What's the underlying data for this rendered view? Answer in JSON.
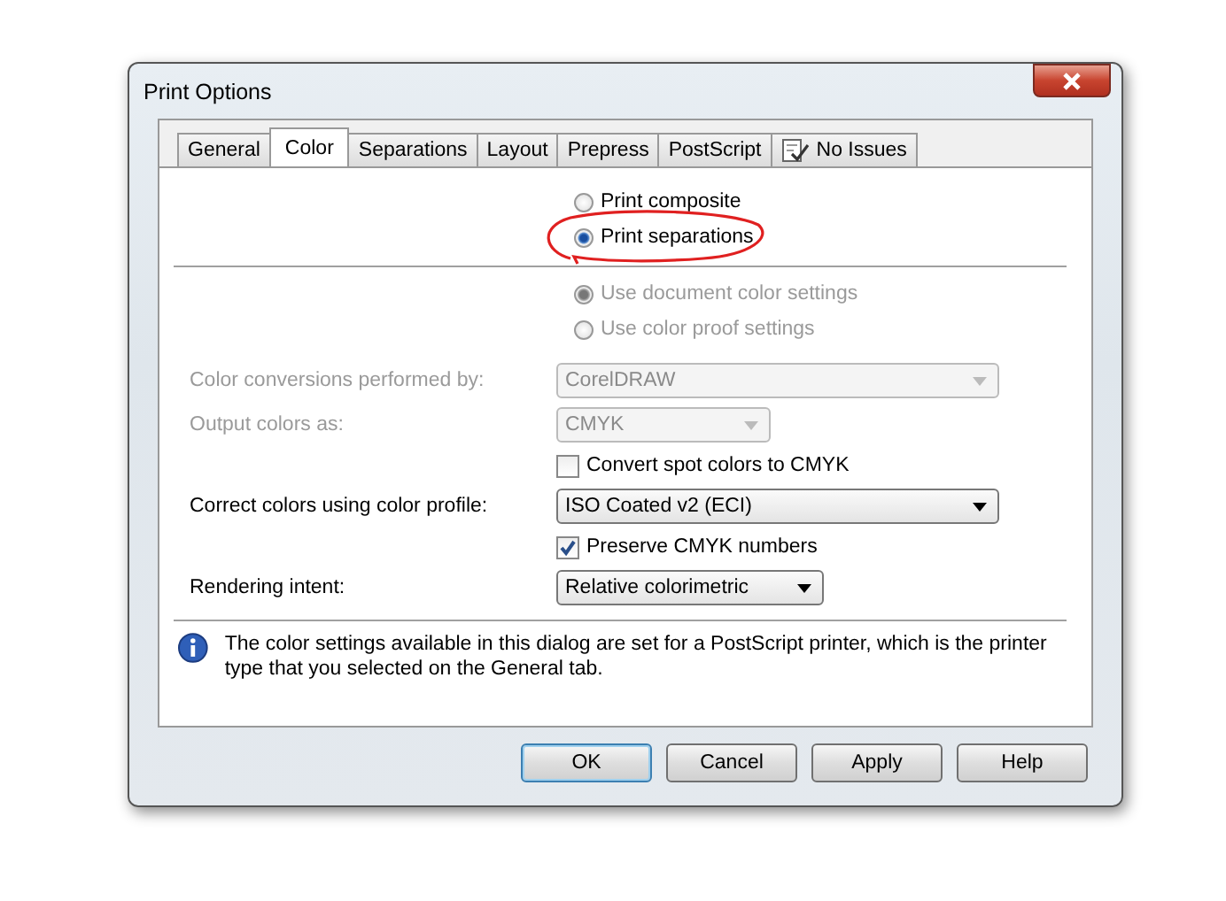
{
  "window": {
    "title": "Print Options"
  },
  "tabs": [
    {
      "label": "General",
      "selected": false,
      "kind": "text"
    },
    {
      "label": "Color",
      "selected": true,
      "kind": "text"
    },
    {
      "label": "Separations",
      "selected": false,
      "kind": "text"
    },
    {
      "label": "Layout",
      "selected": false,
      "kind": "text"
    },
    {
      "label": "Prepress",
      "selected": false,
      "kind": "text"
    },
    {
      "label": "PostScript",
      "selected": false,
      "kind": "text"
    },
    {
      "label": "No Issues",
      "selected": false,
      "kind": "check"
    }
  ],
  "output_mode": [
    {
      "label": "Print composite",
      "selected": false,
      "circled": false
    },
    {
      "label": "Print separations",
      "selected": true,
      "circled": true
    }
  ],
  "color_source": [
    {
      "label": "Use document color settings",
      "selected": true,
      "disabled": true
    },
    {
      "label": "Use color proof settings",
      "selected": false,
      "disabled": true
    }
  ],
  "settings": [
    {
      "kind": "dropdown",
      "label": "Color conversions performed by:",
      "value": "CorelDRAW",
      "disabled": true
    },
    {
      "kind": "dropdown",
      "label": "Output colors as:",
      "value": "CMYK",
      "disabled": true
    },
    {
      "kind": "checkbox",
      "label": "Convert spot colors to CMYK",
      "checked": false
    },
    {
      "kind": "dropdown",
      "label": "Correct colors using color profile:",
      "value": "ISO Coated v2 (ECI)",
      "disabled": false
    },
    {
      "kind": "checkbox",
      "label": "Preserve CMYK numbers",
      "checked": true
    },
    {
      "kind": "dropdown",
      "label": "Rendering intent:",
      "value": "Relative colorimetric",
      "disabled": false
    }
  ],
  "info": "The color settings available in this dialog are set for a PostScript printer, which is the printer type that you selected on the General tab.",
  "buttons": [
    {
      "label": "OK",
      "default": true
    },
    {
      "label": "Cancel",
      "default": false
    },
    {
      "label": "Apply",
      "default": false
    },
    {
      "label": "Help",
      "default": false
    }
  ]
}
